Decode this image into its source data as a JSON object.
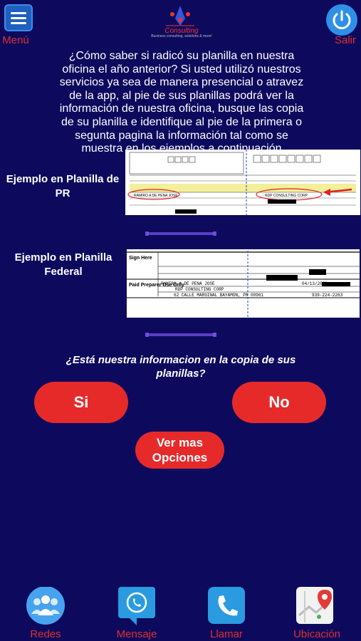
{
  "header": {
    "menu_label": "Menú",
    "logout_label": "Salir",
    "logo_text": "Consulting",
    "logo_sub": "Business consulting, solutions & more!"
  },
  "intro": "¿Cómo saber si radicó su planilla en nuestra oficina el año anterior? Si usted utilizó nuestros servicios ya sea de manera presencial o atravez de la app, al pie de sus planillas podrá ver la información de nuestra oficina, busque las copia de su planilla e identifique al pie de la primera o segunta pagina la información tal como se muestra en los ejemplos a continuación",
  "examples": {
    "pr_label": "Ejemplo en Planilla de PR",
    "federal_label": "Ejemplo en Planilla Federal",
    "pr_doc": {
      "preparer_name": "RAMIRO A DE PENA JOSE",
      "firm": "RDP CONSULTING CORP"
    },
    "federal_doc": {
      "sign_here": "Sign Here",
      "paid_preparer": "Paid Preparer Use Only",
      "preparer_name": "RAMIRO A DE PENA JOSE",
      "firm": "RDP CONSULTING CORP",
      "address": "62 CALLE MARGINAL BAYAMON, PR 00961",
      "date": "04/13/2022",
      "phone": "939-224-2263"
    }
  },
  "question": "¿Está nuestra informacion en la copia de sus planillas?",
  "buttons": {
    "yes": "Si",
    "no": "No",
    "more": "Ver mas Opciones"
  },
  "nav": {
    "redes": "Redes",
    "mensaje": "Mensaje",
    "llamar": "Llamar",
    "ubicacion": "Ubicación"
  },
  "colors": {
    "background": "#0d0a5e",
    "accent_red": "#e62a2a",
    "label_red": "#e02d2d",
    "blue": "#2f8fe6"
  }
}
